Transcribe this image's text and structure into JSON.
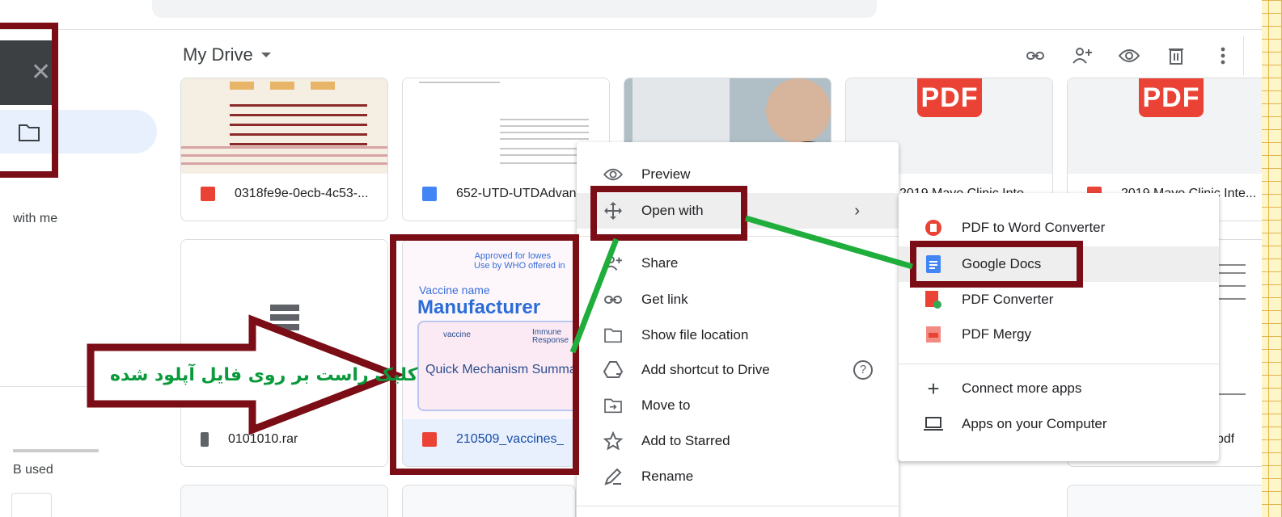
{
  "header": {
    "title": "My Drive",
    "actions": [
      "link-icon",
      "add-person-icon",
      "eye-icon",
      "trash-icon",
      "more-vert-icon"
    ]
  },
  "sidebar": {
    "shared_label": "with me",
    "storage_label": "B used"
  },
  "files": [
    {
      "name": "0318fe9e-0ecb-4c53-...",
      "icon": "image-icon"
    },
    {
      "name": "652-UTD-UTDAdvan",
      "icon": "docs-icon"
    },
    {
      "name": "2019 Mayo Clinic Into",
      "icon": "pdf-icon"
    },
    {
      "name": "2019 Mayo Clinic Inte...",
      "icon": "pdf-icon"
    },
    {
      "name": "0101010.rar",
      "icon": "archive-icon"
    },
    {
      "name": "210509_vaccines_",
      "icon": "pdf-icon"
    },
    {
      "name": "pdf",
      "icon": "pdf-icon"
    }
  ],
  "thumbnail_text": {
    "approved": "Approved for",
    "use_by_who": "Use by WHO",
    "lowest": "lowes",
    "offered": "offered in",
    "vaccine_name": "Vaccine name",
    "manufacturer": "Manufacturer",
    "vaccine": "vaccine",
    "immune": "Immune",
    "response": "Response",
    "summary": "Quick Mechanism Summa"
  },
  "context_menu": [
    {
      "label": "Preview",
      "icon": "eye-icon"
    },
    {
      "label": "Open with",
      "icon": "move-arrows-icon",
      "has_submenu": true
    },
    {
      "label": "Share",
      "icon": "add-person-icon"
    },
    {
      "label": "Get link",
      "icon": "link-icon"
    },
    {
      "label": "Show file location",
      "icon": "folder-icon"
    },
    {
      "label": "Add shortcut to Drive",
      "icon": "drive-shortcut-icon",
      "has_help": true
    },
    {
      "label": "Move to",
      "icon": "move-to-icon"
    },
    {
      "label": "Add to Starred",
      "icon": "star-icon"
    },
    {
      "label": "Rename",
      "icon": "pencil-icon"
    }
  ],
  "open_with_submenu": [
    {
      "label": "PDF to Word Converter",
      "icon": "pdf-to-word-icon"
    },
    {
      "label": "Google Docs",
      "icon": "google-docs-icon"
    },
    {
      "label": "PDF Converter",
      "icon": "pdf-converter-icon"
    },
    {
      "label": "PDF Mergy",
      "icon": "pdf-mergy-icon"
    },
    {
      "label": "Connect more apps",
      "icon": "plus-icon"
    },
    {
      "label": "Apps on your Computer",
      "icon": "laptop-icon"
    }
  ],
  "annotation": {
    "persian_text": "کلیک راست بر روی فایل آپلود شده"
  },
  "colors": {
    "annotation_box": "#7b0d16",
    "annotation_line": "#1fae3c",
    "pdf_red": "#ea4335",
    "docs_blue": "#4285f4"
  }
}
